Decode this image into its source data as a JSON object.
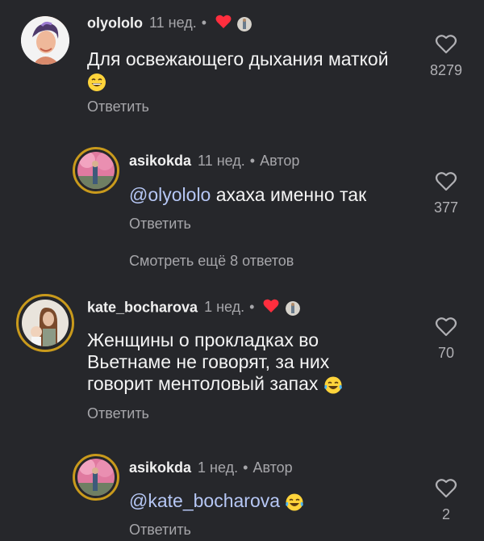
{
  "comments": [
    {
      "username": "olyololo",
      "time": "11 нед.",
      "dot": "•",
      "text": "Для освежающего дыхания маткой",
      "emoji": "grinning-face-with-smiling-eyes",
      "reply_label": "Ответить",
      "likes": "8279",
      "liked_by_author": true
    },
    {
      "username": "asikokda",
      "time": "11 нед.",
      "dot": "•",
      "author_label": "Автор",
      "mention": "@olyololo",
      "text": "ахаха именно так",
      "reply_label": "Ответить",
      "likes": "377"
    },
    {
      "username": "kate_bocharova",
      "time": "1 нед.",
      "dot": "•",
      "text_lines": [
        "Женщины о прокладках во",
        "Вьетнаме не говорят, за них",
        "говорит ментоловый запах"
      ],
      "emoji": "face-with-tears-of-joy",
      "reply_label": "Ответить",
      "likes": "70",
      "liked_by_author": true
    },
    {
      "username": "asikokda",
      "time": "1 нед.",
      "dot": "•",
      "author_label": "Автор",
      "mention": "@kate_bocharova",
      "emoji": "face-with-tears-of-joy",
      "reply_label": "Ответить",
      "likes": "2"
    }
  ],
  "view_more": "Смотреть ещё 8 ответов",
  "colors": {
    "background": "#26272b",
    "heart_red": "#ff2e3e",
    "mention": "#b6c7f5",
    "muted": "#a6a6aa"
  }
}
